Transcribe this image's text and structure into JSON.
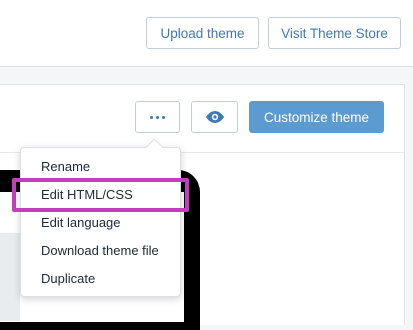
{
  "header": {
    "upload_label": "Upload theme",
    "store_label": "Visit Theme Store"
  },
  "card": {
    "more_icon": "ellipsis-icon",
    "preview_icon": "eye-icon",
    "customize_label": "Customize theme"
  },
  "dropdown": {
    "items": [
      {
        "label": "Rename"
      },
      {
        "label": "Edit HTML/CSS"
      },
      {
        "label": "Edit language"
      },
      {
        "label": "Download theme file"
      },
      {
        "label": "Duplicate"
      }
    ],
    "highlighted_item": "Edit HTML/CSS"
  },
  "colors": {
    "accent": "#3f79b6",
    "primary_button": "#5b9bd1",
    "highlight": "#c43cc0"
  }
}
